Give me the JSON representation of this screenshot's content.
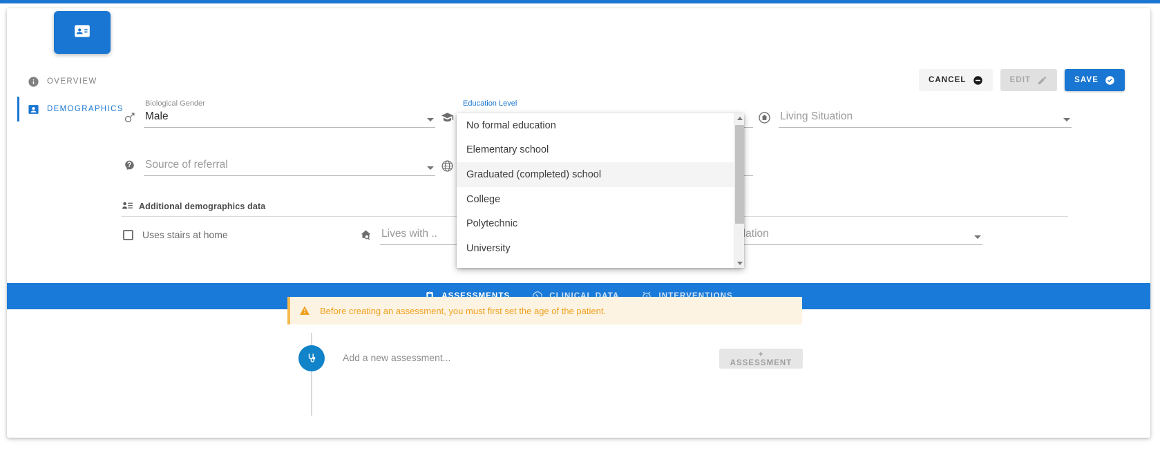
{
  "module": {
    "icon": "contact-card-icon",
    "accent_color": "#1976d2"
  },
  "sidebar": {
    "items": [
      {
        "label": "OVERVIEW",
        "icon": "info-icon",
        "active": false
      },
      {
        "label": "DEMOGRAPHICS",
        "icon": "person-icon",
        "active": true
      }
    ]
  },
  "actions": {
    "cancel_label": "CANCEL",
    "cancel_icon": "minus-circle-icon",
    "edit_label": "EDIT",
    "edit_icon": "pencil-icon",
    "save_label": "SAVE",
    "save_icon": "check-circle-icon"
  },
  "form": {
    "biological_gender": {
      "label": "Biological Gender",
      "value": "Male",
      "icon": "male-gender-icon"
    },
    "education_level": {
      "label": "Education Level",
      "icon": "graduation-cap-icon"
    },
    "living_situation": {
      "placeholder": "Living Situation",
      "icon": "home-icon"
    },
    "source_of_referral": {
      "placeholder": "Source of referral",
      "icon": "referral-head-icon"
    },
    "globe_field": {
      "icon": "globe-icon"
    },
    "subsection": {
      "label": "Additional demographics data",
      "icon": "person-list-icon"
    },
    "uses_stairs": {
      "label": "Uses stairs at home",
      "checked": false
    },
    "lives_with": {
      "placeholder": "Lives with ..",
      "icon": "home-search-icon"
    },
    "accommodation": {
      "placeholder": "modation"
    }
  },
  "dropdown": {
    "options": [
      "No formal education",
      "Elementary school",
      "Graduated (completed) school",
      "College",
      "Polytechnic",
      "University"
    ],
    "hovered_index": 2
  },
  "tabs": [
    {
      "label": "ASSESSMENTS",
      "icon": "clipboard-chart-icon",
      "active": true
    },
    {
      "label": "CLINICAL DATA",
      "icon": "gauge-icon",
      "active": false
    },
    {
      "label": "INTERVENTIONS",
      "icon": "alarm-clock-icon",
      "active": false
    }
  ],
  "warning": {
    "icon": "warning-triangle-icon",
    "text": "Before creating an assessment, you must first set the age of the patient.",
    "color": "#f0a01e"
  },
  "assessment": {
    "avatar_icon": "stethoscope-icon",
    "placeholder": "Add a new assessment...",
    "add_button_label": "+ ASSESSMENT"
  }
}
